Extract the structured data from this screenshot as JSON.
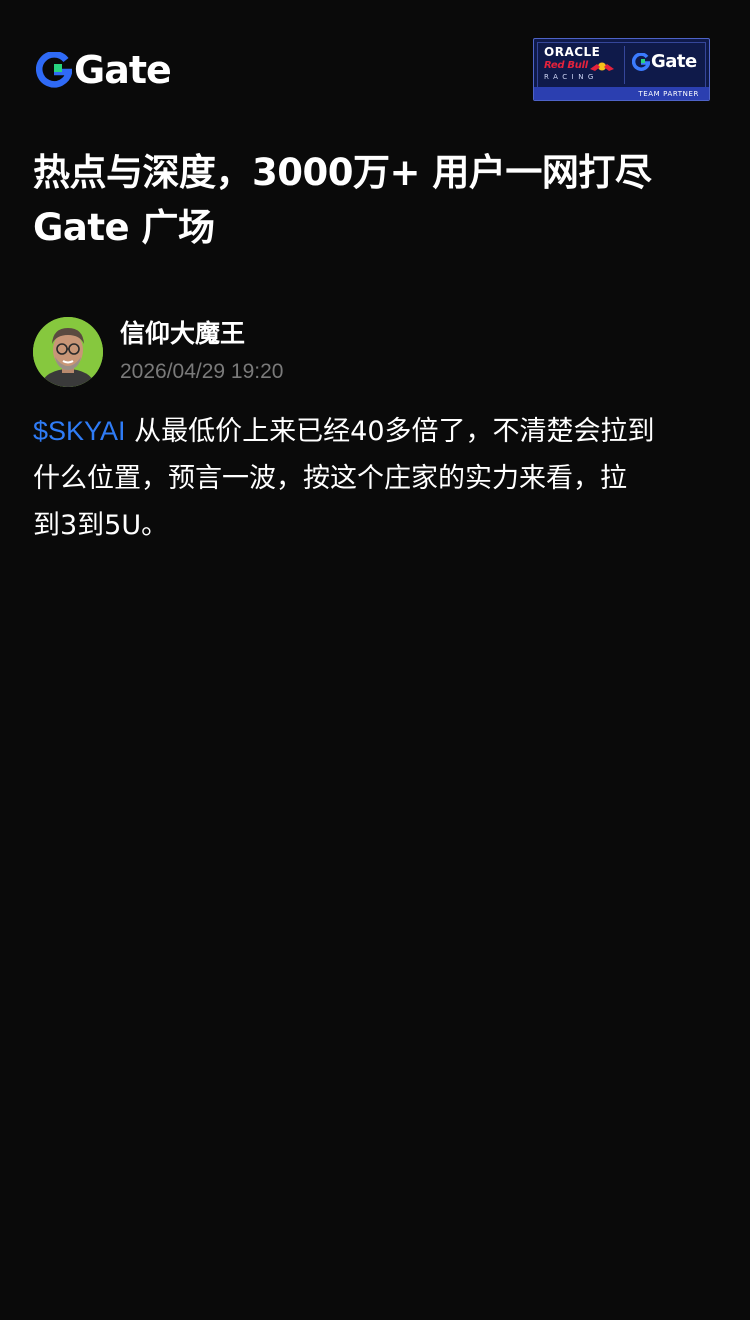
{
  "brand": {
    "name": "Gate",
    "accent_blue": "#2f6af6",
    "accent_green": "#28d37f"
  },
  "partner_badge": {
    "oracle": "ORACLE",
    "red_bull": "Red Bull",
    "racing": "RACING",
    "gate": "Gate",
    "team_partner": "TEAM PARTNER",
    "colors": {
      "background": "#0f1a4a",
      "strip": "#2b3fb0",
      "red": "#e4223c"
    }
  },
  "headline": {
    "line1": "热点与深度，3000万+ 用户一网打尽",
    "line2": "Gate 广场"
  },
  "author": {
    "name": "信仰大魔王",
    "timestamp": "2026/04/29 19:20",
    "avatar_icon": "person-avatar"
  },
  "post": {
    "ticker": "$SKYAI",
    "line1_rest": " 从最低价上来已经40多倍了，不清楚会拉到",
    "line2": "什么位置，预言一波，按这个庄家的实力来看，拉",
    "line3": "到3到5U。",
    "ticker_color": "#2f7cf6"
  }
}
